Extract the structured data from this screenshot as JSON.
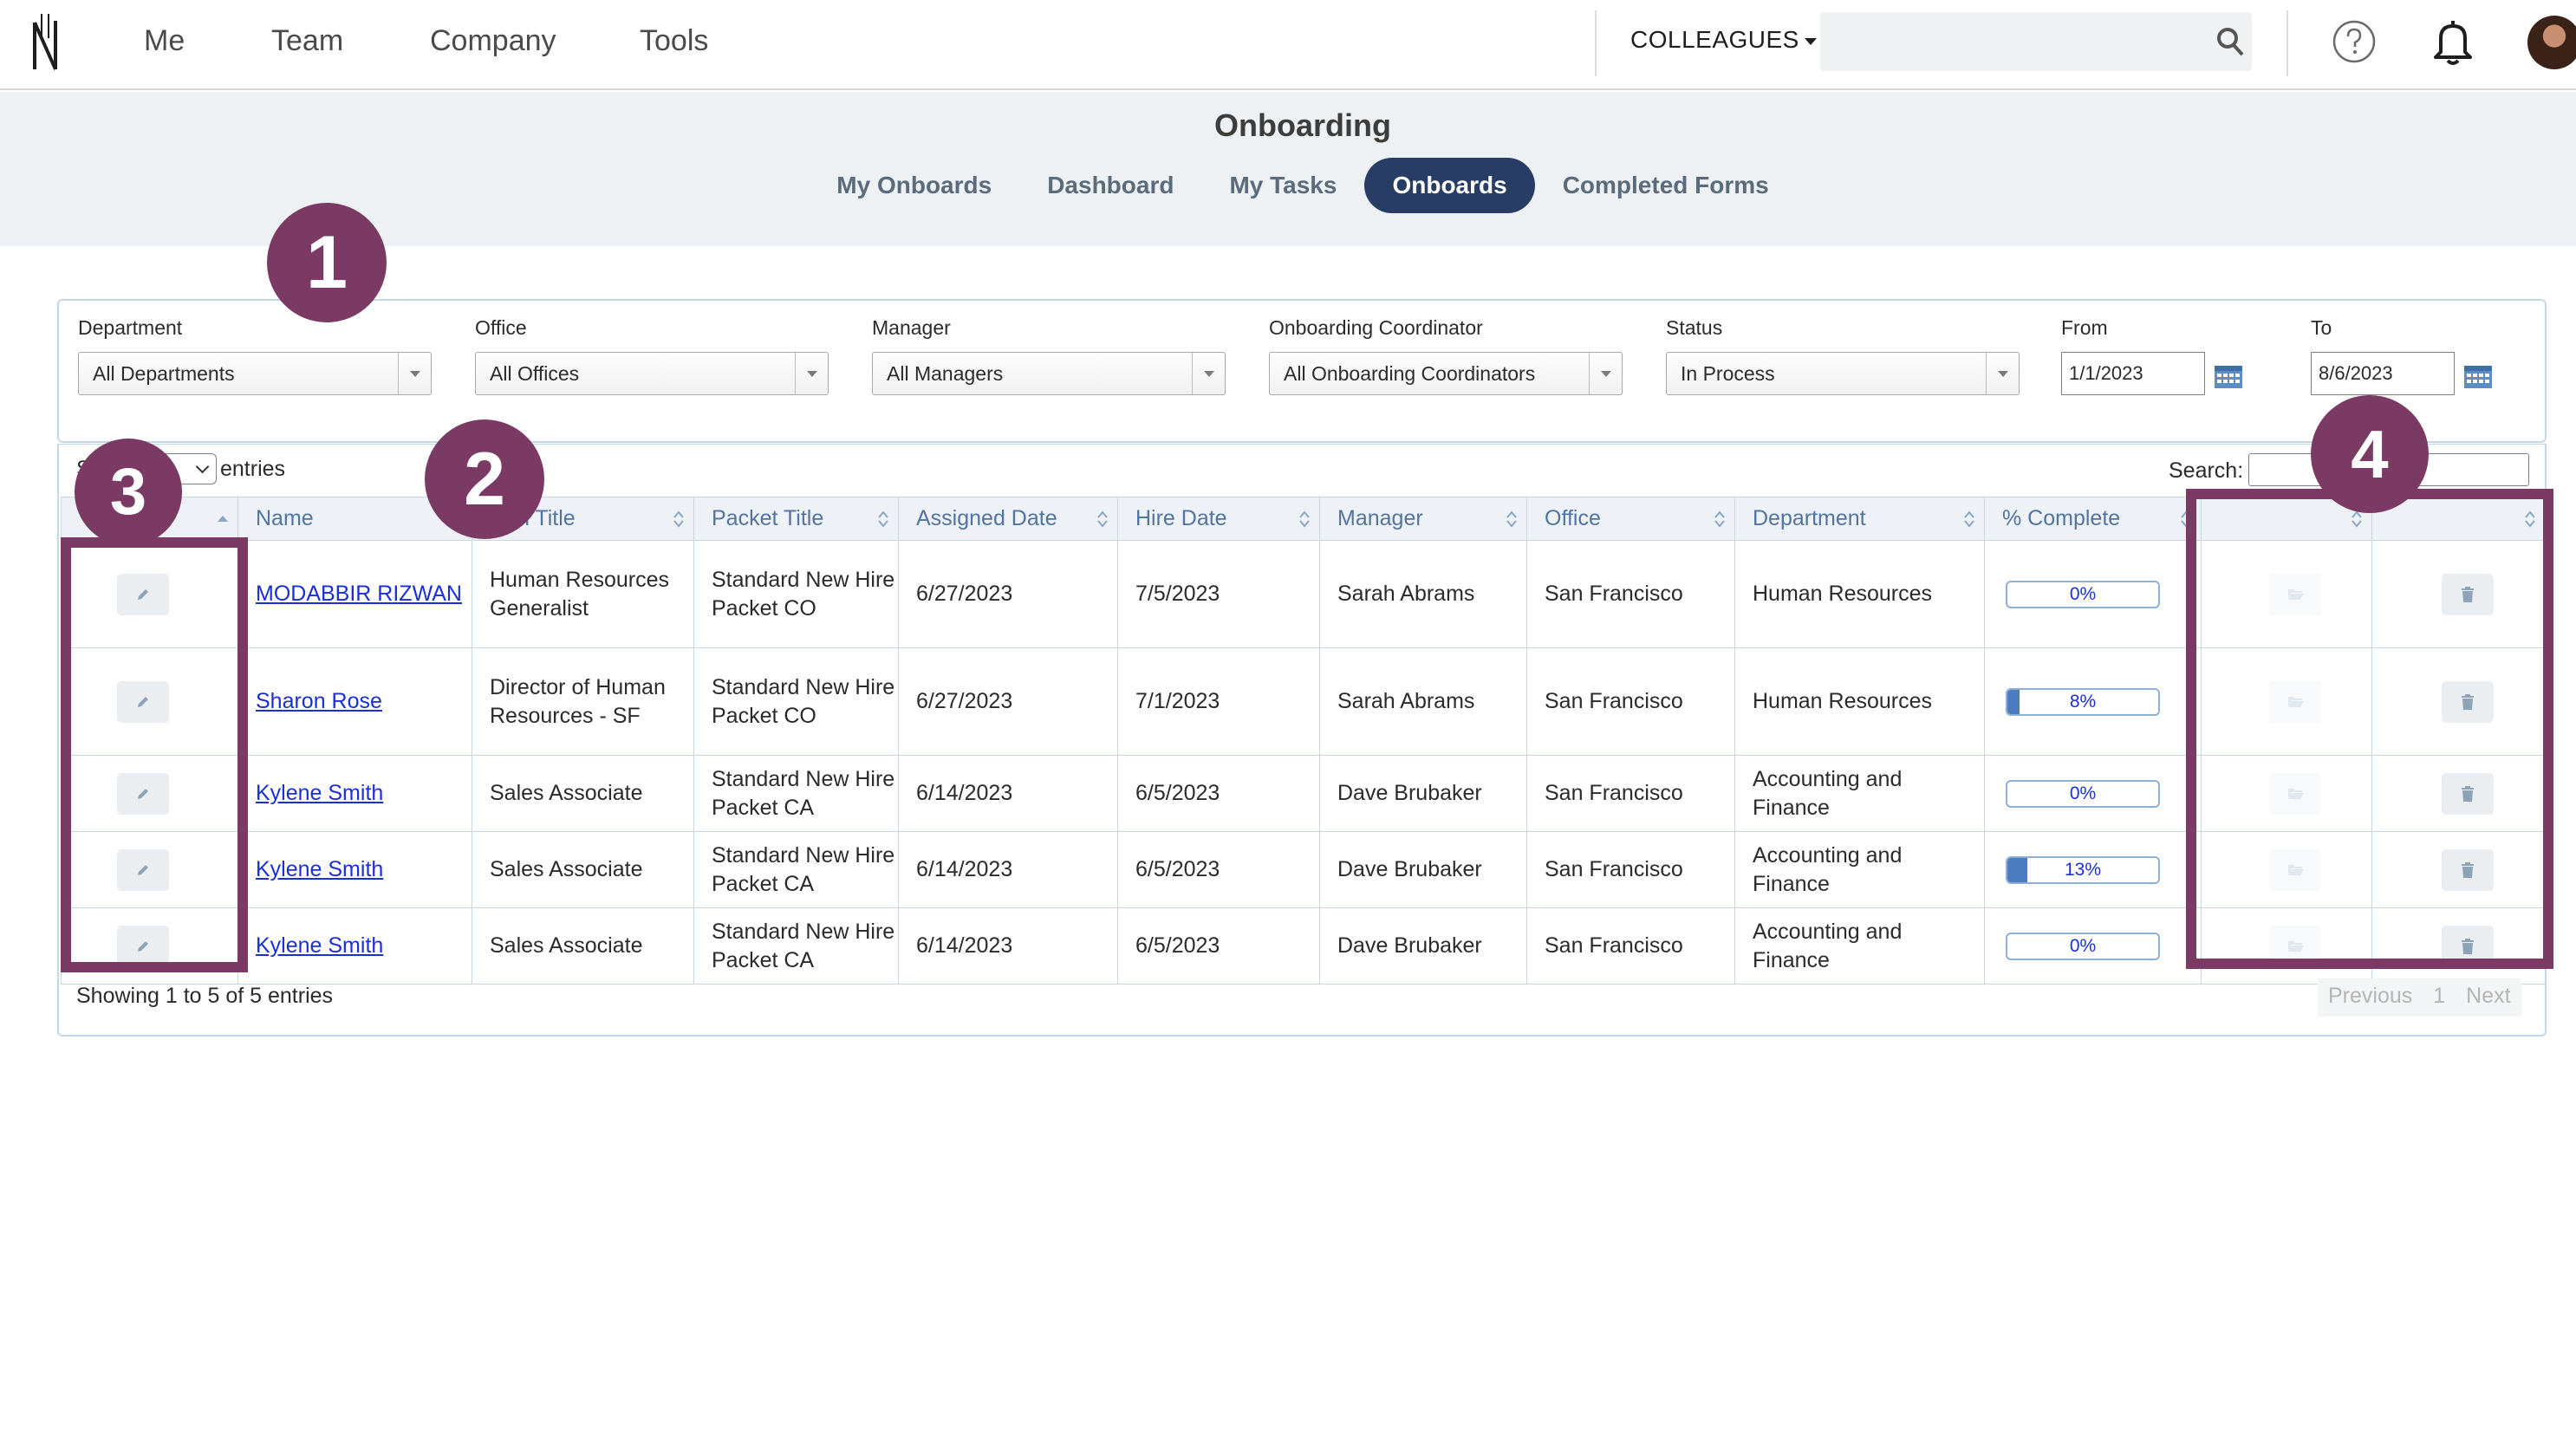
{
  "nav": {
    "items": [
      "Me",
      "Team",
      "Company",
      "Tools"
    ],
    "colleagues_label": "COLLEAGUES",
    "search_placeholder": ""
  },
  "page": {
    "title": "Onboarding",
    "tabs": [
      {
        "label": "My Onboards",
        "active": false
      },
      {
        "label": "Dashboard",
        "active": false
      },
      {
        "label": "My Tasks",
        "active": false
      },
      {
        "label": "Onboards",
        "active": true
      },
      {
        "label": "Completed Forms",
        "active": false
      }
    ]
  },
  "filters": {
    "department": {
      "label": "Department",
      "value": "All Departments"
    },
    "office": {
      "label": "Office",
      "value": "All Offices"
    },
    "manager": {
      "label": "Manager",
      "value": "All Managers"
    },
    "coordinator": {
      "label": "Onboarding Coordinator",
      "value": "All Onboarding Coordinators"
    },
    "status": {
      "label": "Status",
      "value": "In Process"
    },
    "from": {
      "label": "From",
      "value": "1/1/2023"
    },
    "to": {
      "label": "To",
      "value": "8/6/2023"
    }
  },
  "table": {
    "show_label": "Sh",
    "entries_label": "entries",
    "search_label": "Search:",
    "columns": [
      "",
      "Name",
      "ition Title",
      "Packet Title",
      "Assigned Date",
      "Hire Date",
      "Manager",
      "Office",
      "Department",
      "% Complete",
      "",
      ""
    ],
    "rows": [
      {
        "name": "MODABBIR RIZWAN",
        "position": "Human Resources Generalist",
        "packet": "Standard New Hire Packet CO",
        "assigned": "6/27/2023",
        "hire": "7/5/2023",
        "manager": "Sarah Abrams",
        "office": "San Francisco",
        "department": "Human Resources",
        "complete_label": "0%",
        "complete": 0
      },
      {
        "name": "Sharon Rose",
        "position": "Director of Human Resources - SF",
        "packet": "Standard New Hire Packet CO",
        "assigned": "6/27/2023",
        "hire": "7/1/2023",
        "manager": "Sarah Abrams",
        "office": "San Francisco",
        "department": "Human Resources",
        "complete_label": "8%",
        "complete": 8
      },
      {
        "name": "Kylene Smith",
        "position": "Sales Associate",
        "packet": "Standard New Hire Packet CA",
        "assigned": "6/14/2023",
        "hire": "6/5/2023",
        "manager": "Dave Brubaker",
        "office": "San Francisco",
        "department": "Accounting and Finance",
        "complete_label": "0%",
        "complete": 0
      },
      {
        "name": "Kylene Smith",
        "position": "Sales Associate",
        "packet": "Standard New Hire Packet CA",
        "assigned": "6/14/2023",
        "hire": "6/5/2023",
        "manager": "Dave Brubaker",
        "office": "San Francisco",
        "department": "Accounting and Finance",
        "complete_label": "13%",
        "complete": 13
      },
      {
        "name": "Kylene Smith",
        "position": "Sales Associate",
        "packet": "Standard New Hire Packet CA",
        "assigned": "6/14/2023",
        "hire": "6/5/2023",
        "manager": "Dave Brubaker",
        "office": "San Francisco",
        "department": "Accounting and Finance",
        "complete_label": "0%",
        "complete": 0
      }
    ],
    "showing": "Showing 1 to 5 of 5 entries",
    "pager": {
      "previous": "Previous",
      "page": "1",
      "next": "Next"
    }
  },
  "callouts": [
    "1",
    "2",
    "3",
    "4"
  ],
  "colors": {
    "accent": "#7a3a63",
    "active_tab": "#273d66",
    "link": "#1a2fd6",
    "border": "#c6d8e6"
  }
}
